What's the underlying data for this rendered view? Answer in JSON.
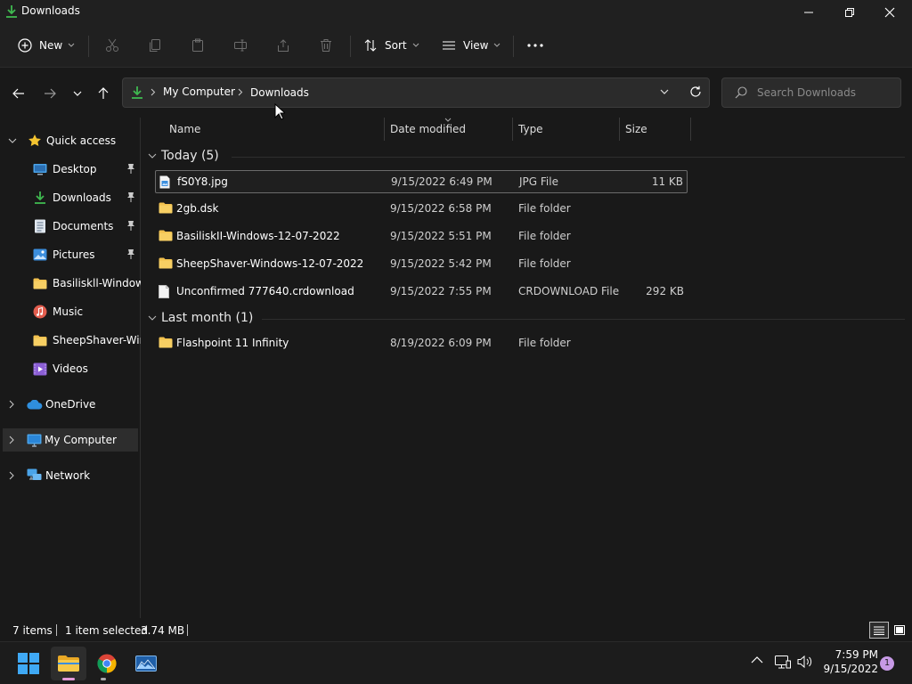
{
  "window": {
    "title": "Downloads"
  },
  "toolbar": {
    "new_label": "New",
    "sort_label": "Sort",
    "view_label": "View"
  },
  "address": {
    "segments": [
      "My Computer",
      "Downloads"
    ]
  },
  "search": {
    "placeholder": "Search Downloads"
  },
  "sidebar": {
    "items": [
      {
        "label": "Quick access"
      },
      {
        "label": "Desktop"
      },
      {
        "label": "Downloads"
      },
      {
        "label": "Documents"
      },
      {
        "label": "Pictures"
      },
      {
        "label": "Basiliskll-Windows"
      },
      {
        "label": "Music"
      },
      {
        "label": "SheepShaver-Wind"
      },
      {
        "label": "Videos"
      },
      {
        "label": "OneDrive"
      },
      {
        "label": "My Computer"
      },
      {
        "label": "Network"
      }
    ]
  },
  "columns": {
    "name": "Name",
    "date": "Date modified",
    "type": "Type",
    "size": "Size"
  },
  "groups": [
    {
      "title": "Today (5)",
      "files": [
        {
          "name": "fS0Y8.jpg",
          "date": "9/15/2022 6:49 PM",
          "type": "JPG File",
          "size": "11 KB",
          "icon": "image-file-icon",
          "selected": true
        },
        {
          "name": "2gb.dsk",
          "date": "9/15/2022 6:58 PM",
          "type": "File folder",
          "size": "",
          "icon": "folder-icon"
        },
        {
          "name": "BasiliskII-Windows-12-07-2022",
          "date": "9/15/2022 5:51 PM",
          "type": "File folder",
          "size": "",
          "icon": "folder-icon"
        },
        {
          "name": "SheepShaver-Windows-12-07-2022",
          "date": "9/15/2022 5:42 PM",
          "type": "File folder",
          "size": "",
          "icon": "folder-icon"
        },
        {
          "name": "Unconfirmed 777640.crdownload",
          "date": "9/15/2022 7:55 PM",
          "type": "CRDOWNLOAD File",
          "size": "292 KB",
          "icon": "file-icon"
        }
      ]
    },
    {
      "title": "Last month (1)",
      "files": [
        {
          "name": "Flashpoint 11 Infinity",
          "date": "8/19/2022 6:09 PM",
          "type": "File folder",
          "size": "",
          "icon": "folder-icon"
        }
      ]
    }
  ],
  "status": {
    "items": "7 items",
    "selected": "1 item selected",
    "size": "3.74 MB"
  },
  "taskbar": {
    "time": "7:59 PM",
    "date": "9/15/2022",
    "notifications": "1"
  },
  "colors": {
    "background": "#191919",
    "chrome": "#202020",
    "folder": "#f2c14e",
    "accent": "#4cc2ff",
    "download_green": "#3fb950"
  }
}
